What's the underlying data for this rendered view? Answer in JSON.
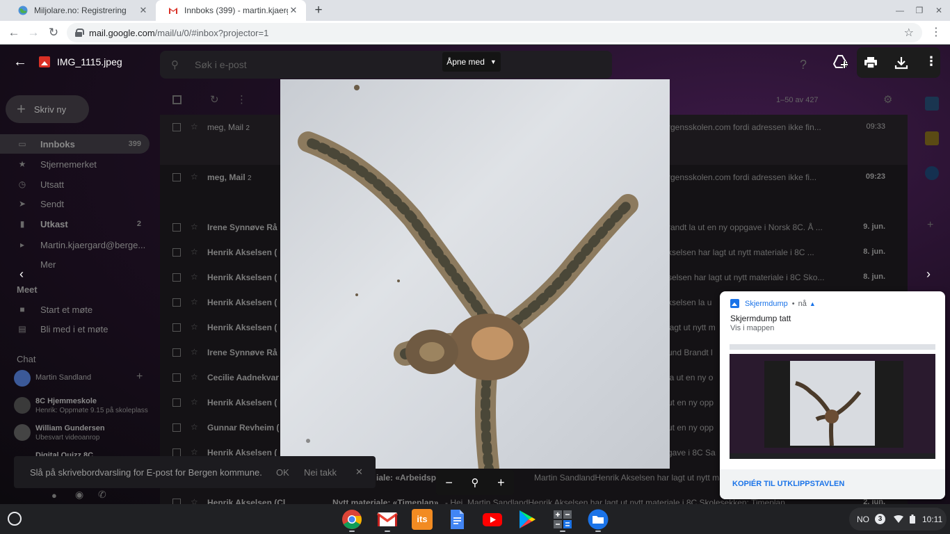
{
  "browser": {
    "tabs": [
      {
        "title": "Miljolare.no: Registrering",
        "active": false
      },
      {
        "title": "Innboks (399) - martin.kjaergard",
        "active": true
      }
    ],
    "url_host": "mail.google.com",
    "url_path": "/mail/u/0/#inbox?projector=1"
  },
  "gmail": {
    "search_placeholder": "Søk i e-post",
    "compose_label": "Skriv ny",
    "list_range": "1–50 av 427",
    "nav": [
      {
        "label": "Innboks",
        "count": "399",
        "icon": "inbox-icon"
      },
      {
        "label": "Stjernemerket",
        "count": "",
        "icon": "star-icon"
      },
      {
        "label": "Utsatt",
        "count": "",
        "icon": "clock-icon"
      },
      {
        "label": "Sendt",
        "count": "",
        "icon": "send-icon"
      },
      {
        "label": "Utkast",
        "count": "2",
        "icon": "draft-icon"
      },
      {
        "label": "Martin.kjaergard@berge...",
        "count": "",
        "icon": "label-icon"
      },
      {
        "label": "Mer",
        "count": "",
        "icon": "expand-icon"
      }
    ],
    "meet_title": "Meet",
    "meet_items": [
      "Start et møte",
      "Bli med i et møte"
    ],
    "chat_title": "Chat",
    "chat_user": "Martin Sandland",
    "chats": [
      {
        "name": "8C Hjemmeskole",
        "sub": "Henrik: Oppmøte 9.15 på skoleplass"
      },
      {
        "name": "William Gundersen",
        "sub": "Ubesvart videoanrop"
      },
      {
        "name": "Digital Quizz 8C",
        "sub": ""
      }
    ],
    "rows": [
      {
        "sender": "meg, Mail",
        "count": "2",
        "snippet": "rgensskolen.com fordi adressen ikke fin...",
        "date": "09:33"
      },
      {
        "sender": "meg, Mail",
        "count": "2",
        "snippet": "rgensskolen.com fordi adressen ikke fi...",
        "date": "09:23"
      },
      {
        "sender": "Irene Synnøve Rå",
        "count": "",
        "snippet": "randt la ut en ny oppgave i Norsk 8C. Å ...",
        "date": "9. jun."
      },
      {
        "sender": "Henrik Akselsen (",
        "count": "",
        "snippet": "kselsen har lagt ut nytt materiale i 8C ...",
        "date": "8. jun."
      },
      {
        "sender": "Henrik Akselsen (",
        "count": "",
        "snippet": "selsen har lagt ut nytt materiale i 8C Sko...",
        "date": "8. jun."
      },
      {
        "sender": "Henrik Akselsen (",
        "count": "",
        "snippet": "kselsen la u",
        "date": ""
      },
      {
        "sender": "Henrik Akselsen (",
        "count": "",
        "snippet": "lagt ut nytt m",
        "date": ""
      },
      {
        "sender": "Irene Synnøve Rå",
        "count": "",
        "snippet": "und Brandt l",
        "date": ""
      },
      {
        "sender": "Cecilie Aadnekvar",
        "count": "",
        "snippet": "la ut en ny o",
        "date": ""
      },
      {
        "sender": "Henrik Akselsen (",
        "count": "",
        "snippet": "ut en ny opp",
        "date": ""
      },
      {
        "sender": "Gunnar Revheim (",
        "count": "",
        "snippet": "ut en ny opp",
        "date": ""
      },
      {
        "sender": "Henrik Akselsen (",
        "count": "",
        "snippet": "gave i 8C Sa",
        "date": ""
      }
    ],
    "row_subject_a": "iale: «Arbeidsp",
    "row_subject_a_snip": "Martin SandlandHenrik Akselsen har lagt ut nytt materi",
    "last_row_sender": "Henrik Akselsen (Cl",
    "last_row_subject": "Nytt materiale: «Timeplan»",
    "last_row_snip": "- Hei, Martin SandlandHenrik Akselsen har lagt ut nytt materiale i 8C Skolesekken: Timeplan",
    "last_row_date": "2. jun."
  },
  "viewer": {
    "filename": "IMG_1115.jpeg",
    "open_with": "Åpne med",
    "toolbar_icons": [
      "add-to-drive-icon",
      "print-icon",
      "download-icon",
      "more-vert-icon"
    ]
  },
  "snackbar": {
    "message": "Slå på skrivebordvarsling for E-post for Bergen kommune.",
    "ok": "OK",
    "no": "Nei takk"
  },
  "notification": {
    "app": "Skjermdump",
    "time": "nå",
    "title": "Skjermdump tatt",
    "subtitle": "Vis i mappen",
    "action": "KOPIÉR TIL UTKLIPPSTAVLEN"
  },
  "shelf": {
    "apps": [
      {
        "name": "chrome-icon",
        "color": "#4285f4"
      },
      {
        "name": "gmail-icon",
        "color": "#ea4335"
      },
      {
        "name": "its-learning-icon",
        "color": "#f28b22"
      },
      {
        "name": "google-docs-icon",
        "color": "#4285f4"
      },
      {
        "name": "youtube-icon",
        "color": "#ff0000"
      },
      {
        "name": "play-store-icon",
        "color": "#01875f"
      },
      {
        "name": "calculator-icon",
        "color": "#5f6368"
      },
      {
        "name": "files-icon",
        "color": "#1a73e8"
      }
    ],
    "ime": "NO",
    "notif_count": "3",
    "clock": "10:11"
  }
}
